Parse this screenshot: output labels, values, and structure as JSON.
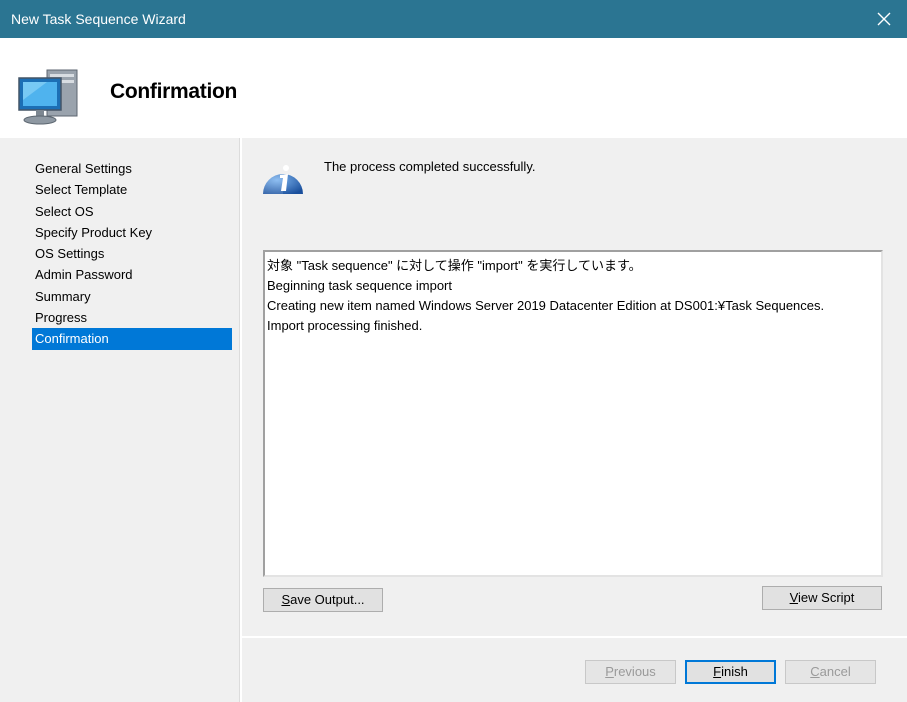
{
  "window": {
    "title": "New Task Sequence Wizard"
  },
  "header": {
    "heading": "Confirmation"
  },
  "sidebar": {
    "items": [
      {
        "label": "General Settings"
      },
      {
        "label": "Select Template"
      },
      {
        "label": "Select OS"
      },
      {
        "label": "Specify Product Key"
      },
      {
        "label": "OS Settings"
      },
      {
        "label": "Admin Password"
      },
      {
        "label": "Summary"
      },
      {
        "label": "Progress"
      },
      {
        "label": "Confirmation",
        "selected": true
      }
    ]
  },
  "main": {
    "status": "The process completed successfully.",
    "output_lines": [
      "対象 \"Task sequence\" に対して操作 \"import\" を実行しています。",
      "Beginning task sequence import",
      "Creating new item named Windows Server 2019 Datacenter Edition at DS001:¥Task Sequences.",
      "Import processing finished."
    ]
  },
  "buttons": {
    "save_output": {
      "mnemonic": "S",
      "rest": "ave Output..."
    },
    "view_script": {
      "mnemonic": "V",
      "rest": "iew Script"
    },
    "previous": {
      "mnemonic": "P",
      "rest": "revious"
    },
    "finish": {
      "mnemonic": "F",
      "rest": "inish"
    },
    "cancel": {
      "mnemonic": "C",
      "rest": "ancel"
    }
  },
  "colors": {
    "titlebar": "#2b7592",
    "selection": "#0078d7",
    "panel": "#f0f0f0"
  }
}
